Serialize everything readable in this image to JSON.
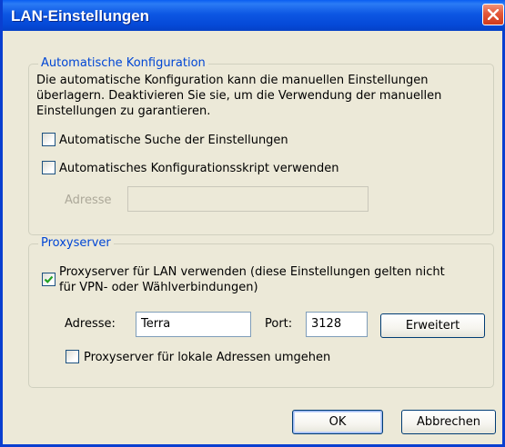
{
  "window": {
    "title": "LAN-Einstellungen"
  },
  "auto_config": {
    "legend": "Automatische Konfiguration",
    "description_lines": [
      "Die automatische Konfiguration kann die manuellen Einstellungen",
      "überlagern. Deaktivieren Sie sie, um die Verwendung der manuellen",
      "Einstellungen zu garantieren."
    ],
    "auto_detect": {
      "label": "Automatische Suche der Einstellungen",
      "checked": false
    },
    "script": {
      "label": "Automatisches Konfigurationsskript verwenden",
      "checked": false
    },
    "address_label": "Adresse",
    "address_value": ""
  },
  "proxy": {
    "legend": "Proxyserver",
    "use_proxy": {
      "label_lines": [
        "Proxyserver für LAN verwenden (diese Einstellungen gelten nicht",
        "für VPN- oder Wählverbindungen)"
      ],
      "checked": true
    },
    "address_label": "Adresse:",
    "address_value": "Terra",
    "port_label": "Port:",
    "port_value": "3128",
    "advanced_button": "Erweitert",
    "bypass_local": {
      "label": "Proxyserver für lokale Adressen umgehen",
      "checked": false
    }
  },
  "buttons": {
    "ok": "OK",
    "cancel": "Abbrechen"
  },
  "colors": {
    "title_bar": "#0549d8",
    "group_legend": "#0046d5",
    "dialog_bg": "#ece9d8",
    "checkmark": "#21a121"
  },
  "icons": {
    "close": "close-icon",
    "check": "checkmark-icon"
  }
}
